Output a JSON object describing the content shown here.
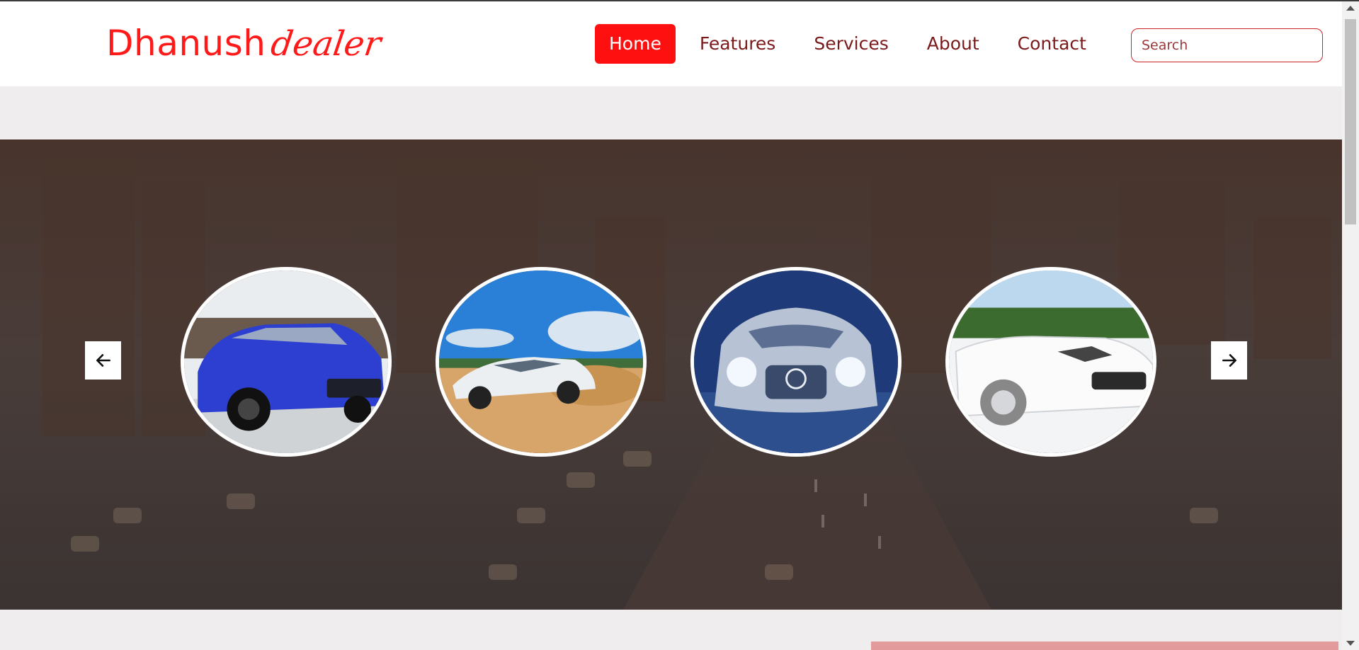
{
  "brand": {
    "name": "Dhanush",
    "tagline": "dealer"
  },
  "nav": {
    "items": [
      {
        "label": "Home",
        "active": true
      },
      {
        "label": "Features",
        "active": false
      },
      {
        "label": "Services",
        "active": false
      },
      {
        "label": "About",
        "active": false
      },
      {
        "label": "Contact",
        "active": false
      }
    ]
  },
  "search": {
    "placeholder": "Search",
    "value": ""
  },
  "carousel": {
    "prev_icon": "arrow-left-icon",
    "next_icon": "arrow-right-icon",
    "slides": [
      {
        "name": "blue-sedan-image"
      },
      {
        "name": "white-bmw-dust-image"
      },
      {
        "name": "silver-mercedes-front-image"
      },
      {
        "name": "white-convertible-image"
      }
    ]
  },
  "colors": {
    "brand_red": "#ff1a1a",
    "nav_text": "#7b1a1a",
    "active_bg": "#ff1010",
    "page_bg": "#efeded"
  }
}
